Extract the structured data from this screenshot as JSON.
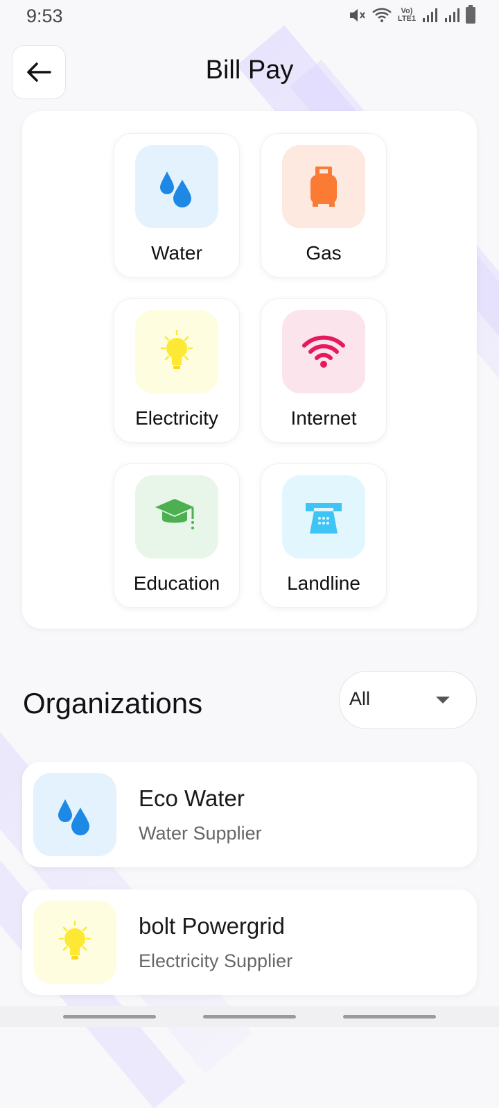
{
  "status_bar": {
    "time": "9:53",
    "network_label_top": "Vo)",
    "network_label_bottom": "LTE1"
  },
  "header": {
    "title": "Bill Pay",
    "back_icon": "arrow-left-icon"
  },
  "categories": [
    {
      "label": "Water",
      "icon": "water-drops-icon",
      "bg": "#e4f2fd",
      "color": "#1e88e5"
    },
    {
      "label": "Gas",
      "icon": "gas-cylinder-icon",
      "bg": "#fde9df",
      "color": "#fb7a34"
    },
    {
      "label": "Electricity",
      "icon": "light-bulb-icon",
      "bg": "#fefde0",
      "color": "#fde835"
    },
    {
      "label": "Internet",
      "icon": "wifi-icon",
      "bg": "#fce4ec",
      "color": "#e5195f"
    },
    {
      "label": "Education",
      "icon": "graduation-cap-icon",
      "bg": "#e8f5e9",
      "color": "#4caf50"
    },
    {
      "label": "Landline",
      "icon": "telephone-icon",
      "bg": "#e2f6fd",
      "color": "#3ec5f5"
    }
  ],
  "organizations_section": {
    "title": "Organizations",
    "filter": {
      "selected": "All"
    },
    "items": [
      {
        "name": "Eco Water",
        "subtitle": "Water Supplier",
        "icon": "water-drops-icon",
        "bg": "#e4f2fd"
      },
      {
        "name": "bolt Powergrid",
        "subtitle": "Electricity Supplier",
        "icon": "light-bulb-icon",
        "bg": "#fefde0"
      }
    ]
  }
}
